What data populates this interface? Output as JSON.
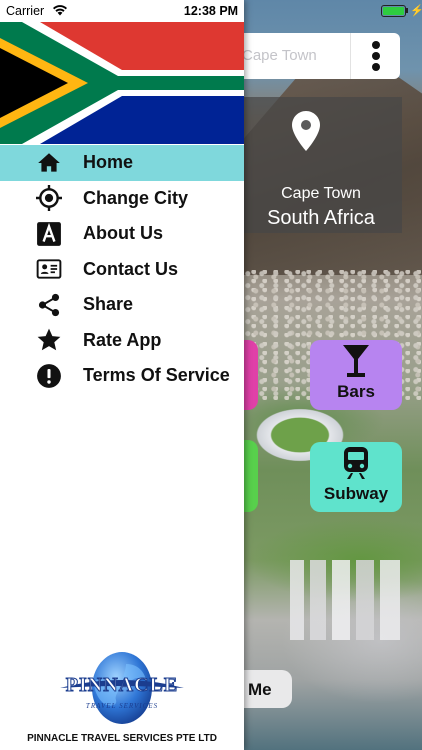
{
  "status_bar": {
    "carrier": "Carrier",
    "time": "12:38 PM",
    "battery_level": 1.0
  },
  "search": {
    "placeholder": "Cape Town"
  },
  "location": {
    "city": "Cape Town",
    "country": "South Africa"
  },
  "categories": [
    {
      "label": "Bars",
      "icon": "cocktail-icon",
      "color": "#b784f0"
    },
    {
      "label": "Subway",
      "icon": "train-icon",
      "color": "#5fe3cc"
    }
  ],
  "me_button": {
    "label": "Me"
  },
  "drawer": {
    "menu": [
      {
        "label": "Home",
        "icon": "home-icon",
        "active": true
      },
      {
        "label": "Change City",
        "icon": "crosshair-icon",
        "active": false
      },
      {
        "label": "About Us",
        "icon": "letter-a-icon",
        "active": false
      },
      {
        "label": "Contact Us",
        "icon": "contact-card-icon",
        "active": false
      },
      {
        "label": "Share",
        "icon": "share-icon",
        "active": false
      },
      {
        "label": "Rate App",
        "icon": "star-icon",
        "active": false
      },
      {
        "label": "Terms Of Service",
        "icon": "alert-circle-icon",
        "active": false
      }
    ],
    "logo_text": "PINNACLE",
    "logo_subtext": "TRAVEL SERVICES",
    "company": "PINNACLE TRAVEL SERVICES PTE LTD"
  },
  "colors": {
    "active_menu_bg": "#7fd8dc",
    "flag_red": "#de3831",
    "flag_blue": "#002395",
    "flag_green": "#007a4d",
    "flag_gold": "#ffb612"
  }
}
